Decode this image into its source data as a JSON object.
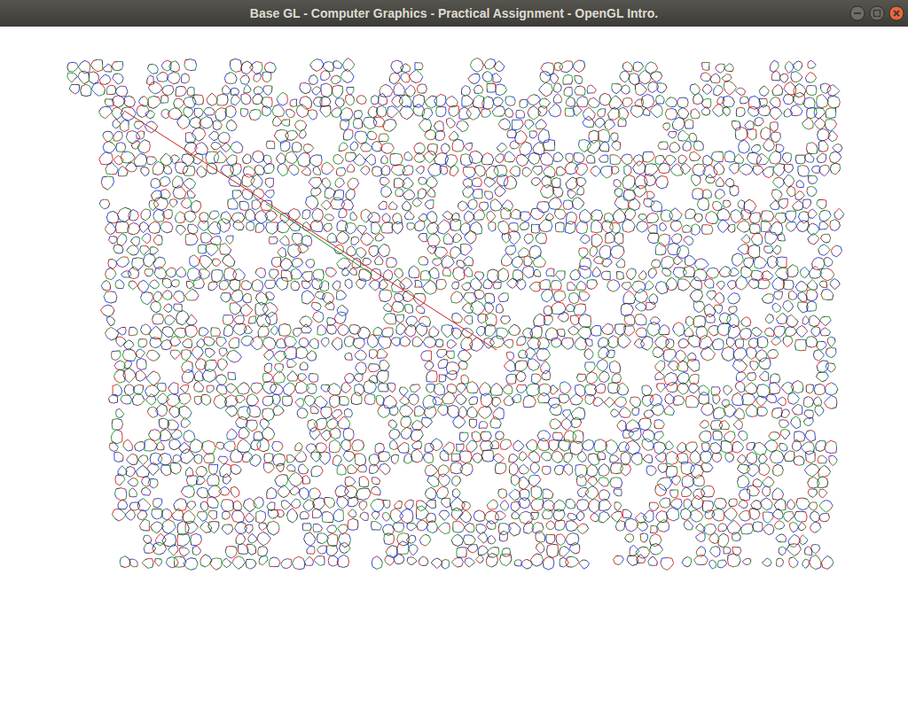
{
  "window": {
    "title": "Base GL - Computer Graphics - Practical Assignment - OpenGL Intro."
  }
}
